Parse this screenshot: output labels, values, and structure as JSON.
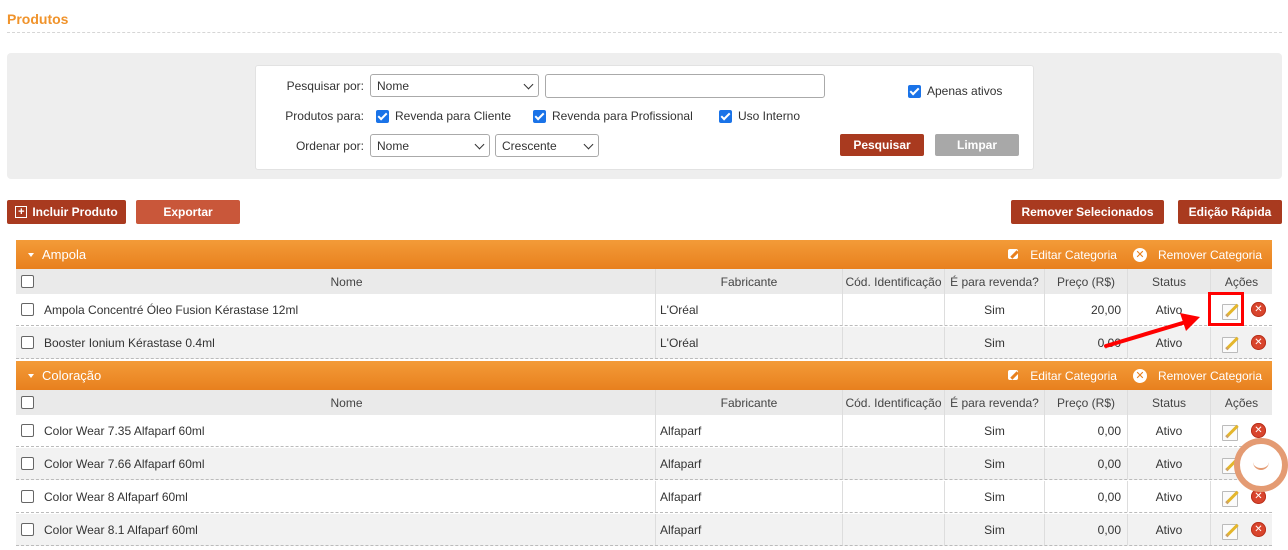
{
  "page": {
    "title": "Produtos"
  },
  "search": {
    "search_by_label": "Pesquisar por:",
    "search_by_value": "Nome",
    "search_text": "",
    "only_active_label": "Apenas ativos",
    "only_active_checked": true,
    "products_for_label": "Produtos para:",
    "products_for": [
      {
        "label": "Revenda para Cliente",
        "checked": true
      },
      {
        "label": "Revenda para Profissional",
        "checked": true
      },
      {
        "label": "Uso Interno",
        "checked": true
      }
    ],
    "order_by_label": "Ordenar por:",
    "order_by_value": "Nome",
    "order_dir_value": "Crescente",
    "search_button": "Pesquisar",
    "clear_button": "Limpar"
  },
  "toolbar": {
    "add_product": "Incluir Produto",
    "export": "Exportar",
    "remove_selected": "Remover Selecionados",
    "quick_edit": "Edição Rápida"
  },
  "columns": {
    "nome": "Nome",
    "fabricante": "Fabricante",
    "cod": "Cód. Identificação",
    "revenda": "É para revenda?",
    "preco": "Preço (R$)",
    "status": "Status",
    "acoes": "Ações"
  },
  "category_actions": {
    "edit": "Editar Categoria",
    "remove": "Remover Categoria"
  },
  "categories": [
    {
      "name": "Ampola",
      "rows": [
        {
          "nome": "Ampola Concentré Óleo Fusion Kérastase 12ml",
          "fabricante": "L'Oréal",
          "cod": "",
          "revenda": "Sim",
          "preco": "20,00",
          "status": "Ativo"
        },
        {
          "nome": "Booster Ionium Kérastase 0.4ml",
          "fabricante": "L'Oréal",
          "cod": "",
          "revenda": "Sim",
          "preco": "0,00",
          "status": "Ativo"
        }
      ]
    },
    {
      "name": "Coloração",
      "rows": [
        {
          "nome": "Color Wear 7.35 Alfaparf 60ml",
          "fabricante": "Alfaparf",
          "cod": "",
          "revenda": "Sim",
          "preco": "0,00",
          "status": "Ativo"
        },
        {
          "nome": "Color Wear 7.66 Alfaparf 60ml",
          "fabricante": "Alfaparf",
          "cod": "",
          "revenda": "Sim",
          "preco": "0,00",
          "status": "Ativo"
        },
        {
          "nome": "Color Wear 8 Alfaparf 60ml",
          "fabricante": "Alfaparf",
          "cod": "",
          "revenda": "Sim",
          "preco": "0,00",
          "status": "Ativo"
        },
        {
          "nome": "Color Wear 8.1 Alfaparf 60ml",
          "fabricante": "Alfaparf",
          "cod": "",
          "revenda": "Sim",
          "preco": "0,00",
          "status": "Ativo"
        }
      ]
    }
  ],
  "icons": {
    "edit": "pencil-icon",
    "delete": "delete-icon",
    "add": "plus-icon",
    "chat": "chat-icon"
  },
  "colors": {
    "title": "#f0932b",
    "category_bar": "#e8801e",
    "dark_button": "#a93a1f",
    "light_button": "#c9573a",
    "checkbox": "#1a73e8",
    "annotation": "#ff0000"
  }
}
